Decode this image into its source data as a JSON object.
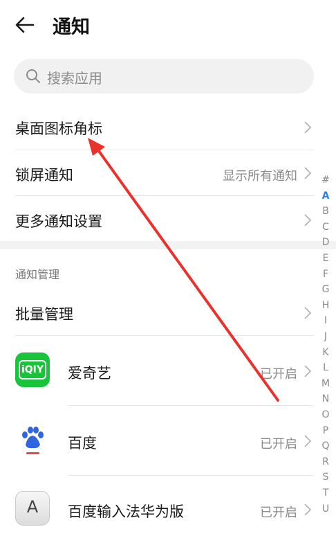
{
  "header": {
    "title": "通知"
  },
  "search": {
    "placeholder": "搜索应用"
  },
  "settings": [
    {
      "label": "桌面图标角标",
      "value": ""
    },
    {
      "label": "锁屏通知",
      "value": "显示所有通知"
    },
    {
      "label": "更多通知设置",
      "value": ""
    }
  ],
  "section_title": "通知管理",
  "batch": {
    "label": "批量管理"
  },
  "apps": [
    {
      "name": "爱奇艺",
      "status": "已开启",
      "icon_text": "iQIY"
    },
    {
      "name": "百度",
      "status": "已开启"
    },
    {
      "name": "百度输入法华为版",
      "status": "已开启",
      "icon_text": "A"
    }
  ],
  "index_letters": [
    "#",
    "A",
    "B",
    "C",
    "D",
    "E",
    "F",
    "G",
    "H",
    "I",
    "J",
    "K",
    "L",
    "M",
    "N",
    "O",
    "P",
    "Q",
    "R",
    "S",
    "T",
    "U"
  ],
  "colors": {
    "accent": "#2b7df0",
    "annotation_arrow": "#e8322b",
    "iqiyi_green": "#19c33a",
    "baidu_blue": "#2f66e0"
  },
  "icons": [
    "back-arrow-icon",
    "search-icon",
    "chevron-right-icon",
    "baidu-paw-icon"
  ]
}
